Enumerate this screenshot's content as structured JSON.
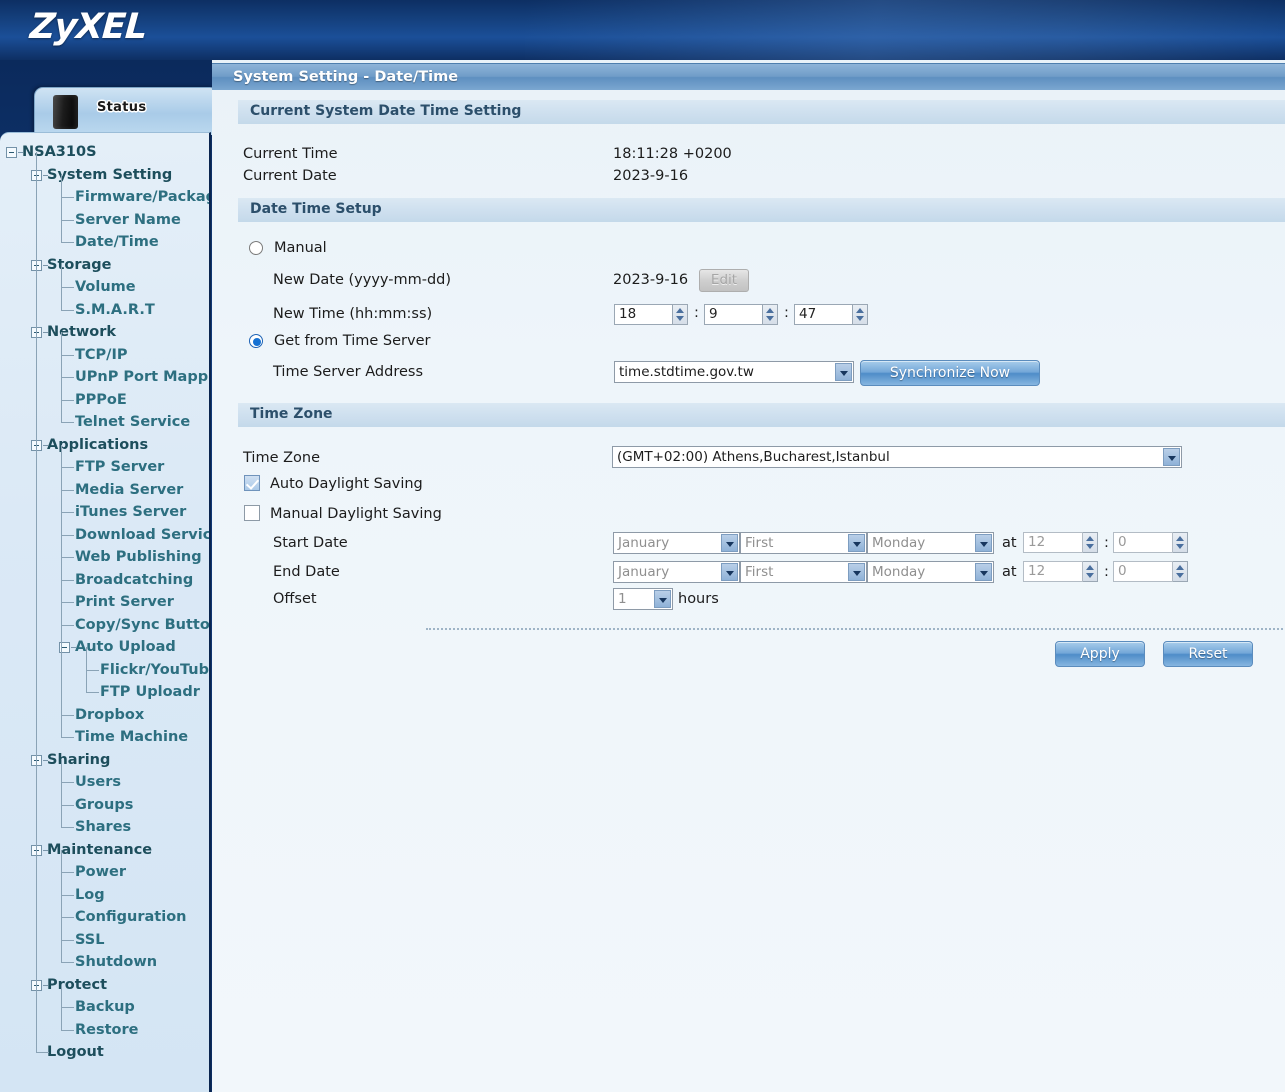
{
  "brand": {
    "name": "ZyXEL"
  },
  "sidebar": {
    "status_label": "Status",
    "tree": [
      {
        "label": "NSA310S",
        "level": 0,
        "toggle": true
      },
      {
        "label": "System Setting",
        "level": 1,
        "toggle": true
      },
      {
        "label": "Firmware/Package",
        "level": 2,
        "toggle": false
      },
      {
        "label": "Server Name",
        "level": 2,
        "toggle": false
      },
      {
        "label": "Date/Time",
        "level": 2,
        "toggle": false
      },
      {
        "label": "Storage",
        "level": 1,
        "toggle": true
      },
      {
        "label": "Volume",
        "level": 2,
        "toggle": false
      },
      {
        "label": "S.M.A.R.T",
        "level": 2,
        "toggle": false
      },
      {
        "label": "Network",
        "level": 1,
        "toggle": true
      },
      {
        "label": "TCP/IP",
        "level": 2,
        "toggle": false
      },
      {
        "label": "UPnP Port Mapping",
        "level": 2,
        "toggle": false
      },
      {
        "label": "PPPoE",
        "level": 2,
        "toggle": false
      },
      {
        "label": "Telnet Service",
        "level": 2,
        "toggle": false
      },
      {
        "label": "Applications",
        "level": 1,
        "toggle": true
      },
      {
        "label": "FTP Server",
        "level": 2,
        "toggle": false
      },
      {
        "label": "Media Server",
        "level": 2,
        "toggle": false
      },
      {
        "label": "iTunes Server",
        "level": 2,
        "toggle": false
      },
      {
        "label": "Download Service",
        "level": 2,
        "toggle": false
      },
      {
        "label": "Web Publishing",
        "level": 2,
        "toggle": false
      },
      {
        "label": "Broadcatching",
        "level": 2,
        "toggle": false
      },
      {
        "label": "Print Server",
        "level": 2,
        "toggle": false
      },
      {
        "label": "Copy/Sync Button",
        "level": 2,
        "toggle": false
      },
      {
        "label": "Auto Upload",
        "level": 2,
        "toggle": true
      },
      {
        "label": "Flickr/YouTube",
        "level": 3,
        "toggle": false
      },
      {
        "label": "FTP Uploadr",
        "level": 3,
        "toggle": false
      },
      {
        "label": "Dropbox",
        "level": 2,
        "toggle": false
      },
      {
        "label": "Time Machine",
        "level": 2,
        "toggle": false
      },
      {
        "label": "Sharing",
        "level": 1,
        "toggle": true
      },
      {
        "label": "Users",
        "level": 2,
        "toggle": false
      },
      {
        "label": "Groups",
        "level": 2,
        "toggle": false
      },
      {
        "label": "Shares",
        "level": 2,
        "toggle": false
      },
      {
        "label": "Maintenance",
        "level": 1,
        "toggle": true
      },
      {
        "label": "Power",
        "level": 2,
        "toggle": false
      },
      {
        "label": "Log",
        "level": 2,
        "toggle": false
      },
      {
        "label": "Configuration",
        "level": 2,
        "toggle": false
      },
      {
        "label": "SSL",
        "level": 2,
        "toggle": false
      },
      {
        "label": "Shutdown",
        "level": 2,
        "toggle": false
      },
      {
        "label": "Protect",
        "level": 1,
        "toggle": true
      },
      {
        "label": "Backup",
        "level": 2,
        "toggle": false
      },
      {
        "label": "Restore",
        "level": 2,
        "toggle": false
      },
      {
        "label": "Logout",
        "level": 1,
        "toggle": false
      }
    ]
  },
  "page": {
    "title": "System Setting - Date/Time"
  },
  "current_system": {
    "heading": "Current System Date Time Setting",
    "time_label": "Current Time",
    "time_value": "18:11:28 +0200",
    "date_label": "Current Date",
    "date_value": "2023-9-16"
  },
  "date_time_setup": {
    "heading": "Date Time Setup",
    "manual_label": "Manual",
    "manual_selected": false,
    "new_date_label": "New Date (yyyy-mm-dd)",
    "new_date_value": "2023-9-16",
    "edit_button": "Edit",
    "new_time_label": "New Time (hh:mm:ss)",
    "new_time_hh": "18",
    "new_time_mm": "9",
    "new_time_ss": "47",
    "time_server_radio_label": "Get from Time Server",
    "time_server_selected": true,
    "time_server_addr_label": "Time Server Address",
    "time_server_addr_value": "time.stdtime.gov.tw",
    "sync_button": "Synchronize Now"
  },
  "time_zone": {
    "heading": "Time Zone",
    "tz_label": "Time Zone",
    "tz_value": "(GMT+02:00) Athens,Bucharest,Istanbul",
    "auto_dst_label": "Auto Daylight Saving",
    "auto_dst_checked": true,
    "manual_dst_label": "Manual Daylight Saving",
    "manual_dst_checked": false,
    "start_date_label": "Start Date",
    "start_month": "January",
    "start_week": "First",
    "start_day": "Monday",
    "start_at_label": "at",
    "start_hour": "12",
    "start_minute": "0",
    "end_date_label": "End Date",
    "end_month": "January",
    "end_week": "First",
    "end_day": "Monday",
    "end_at_label": "at",
    "end_hour": "12",
    "end_minute": "0",
    "offset_label": "Offset",
    "offset_value": "1",
    "offset_units": "hours",
    "colon": ":"
  },
  "footer": {
    "apply": "Apply",
    "reset": "Reset"
  }
}
